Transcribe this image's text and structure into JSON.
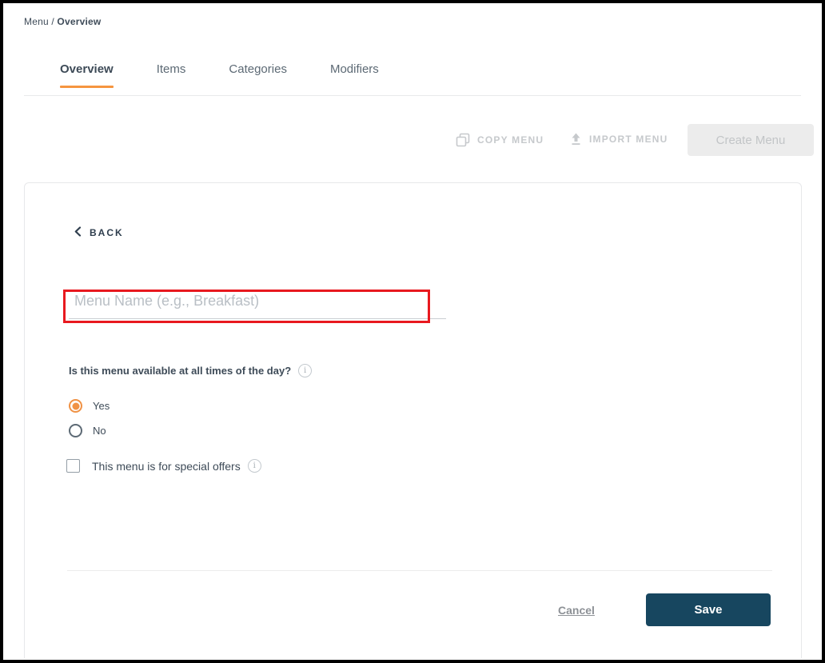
{
  "breadcrumb": {
    "prefix": "Menu / ",
    "current": "Overview"
  },
  "tabs": {
    "items": [
      {
        "label": "Overview",
        "active": true
      },
      {
        "label": "Items",
        "active": false
      },
      {
        "label": "Categories",
        "active": false
      },
      {
        "label": "Modifiers",
        "active": false
      }
    ]
  },
  "toolbar": {
    "copy_label": "COPY MENU",
    "import_label": "IMPORT MENU",
    "create_label": "Create Menu",
    "create_disabled": true
  },
  "form": {
    "back_label": "BACK",
    "menu_name": {
      "value": "",
      "placeholder": "Menu Name (e.g., Breakfast)"
    },
    "availability_question": "Is this menu available at all times of the day?",
    "availability_options": [
      {
        "label": "Yes",
        "selected": true
      },
      {
        "label": "No",
        "selected": false
      }
    ],
    "special_offers": {
      "label": "This menu is for special offers",
      "checked": false
    },
    "cancel_label": "Cancel",
    "save_label": "Save"
  },
  "icons": {
    "copy": "copy-icon",
    "import": "upload-icon",
    "back": "chevron-left-icon",
    "info": "info-icon",
    "info_glyph": "i"
  },
  "annotation": {
    "type": "red highlight box around menu name input",
    "color": "#E8191F"
  },
  "colors": {
    "accent_orange": "#F6953F",
    "primary_navy": "#17465F",
    "text_dark": "#3E4B58",
    "disabled_gray": "#C6C9CC"
  }
}
